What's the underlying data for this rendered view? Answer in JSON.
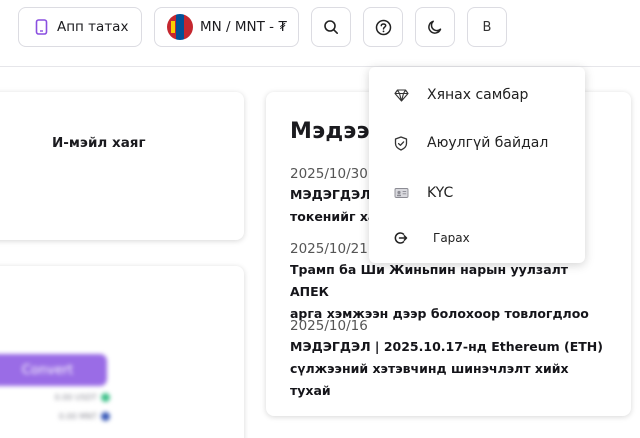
{
  "header": {
    "app_button_label": "Апп татах",
    "language_label": "MN / MNT - ₮",
    "avatar_initial": "B"
  },
  "profile_card": {
    "email_label": "И-мэйл хаяг"
  },
  "convert_card": {
    "convert_label": "Convert",
    "balances": [
      "0.00 USDT",
      "0.00 MNT"
    ]
  },
  "news": {
    "title": "Мэдээл",
    "items": [
      {
        "date": "2025/10/30",
        "line1": "МЭДЭГДЭЛ",
        "line2": "токенийг хас"
      },
      {
        "date": "2025/10/21",
        "line1": "Трамп ба Ши Жиньпин нарын уулзалт АПЕК",
        "line2": "арга хэмжээн дээр болохоор товлогдлоо"
      },
      {
        "date": "2025/10/16",
        "line1": "МЭДЭГДЭЛ | 2025.10.17-нд Ethereum (ETH)",
        "line2": "сүлжээний хэтэвчинд шинэчлэлт хийх тухай"
      }
    ]
  },
  "user_menu": {
    "items": [
      {
        "label": "Хянах самбар",
        "icon": "diamond-icon"
      },
      {
        "label": "Аюулгүй байдал",
        "icon": "shield-check-icon"
      },
      {
        "label": "KYC",
        "icon": "id-card-icon"
      },
      {
        "label": "Гарах",
        "icon": "logout-icon"
      }
    ]
  },
  "colors": {
    "accent": "#9a6ce6",
    "flag_red": "#c4272f",
    "flag_blue": "#015197",
    "flag_soyombo": "#f9cf02"
  }
}
